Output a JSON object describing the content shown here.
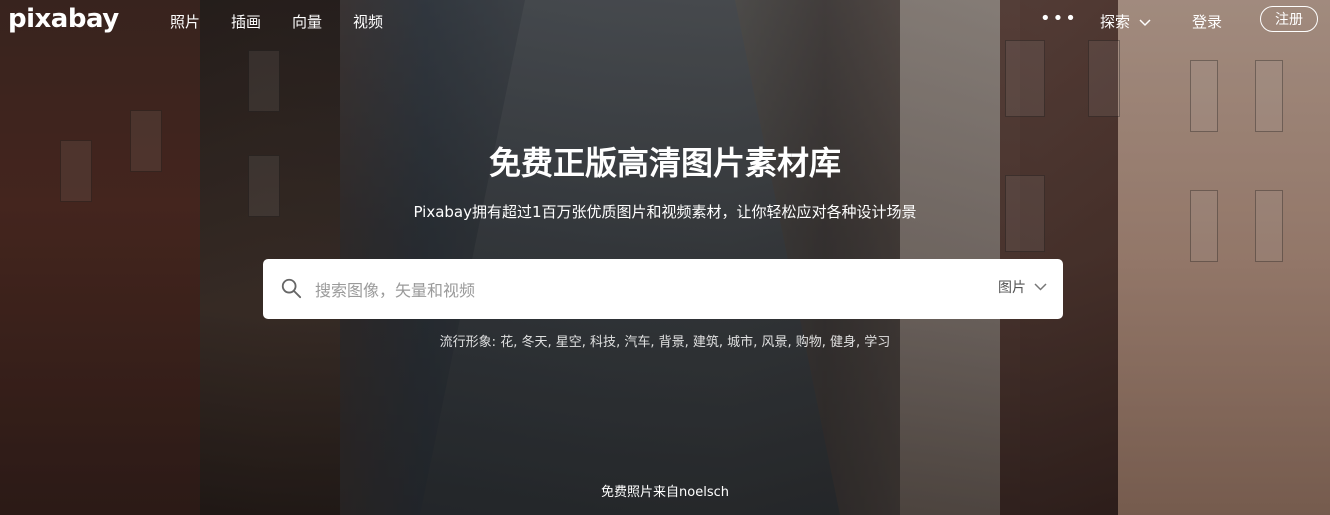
{
  "header": {
    "logo": "pixabay",
    "nav": [
      "照片",
      "插画",
      "向量",
      "视频"
    ],
    "more_label": "•••",
    "explore_label": "探索",
    "login_label": "登录",
    "signup_label": "注册"
  },
  "hero": {
    "headline": "免费正版高清图片素材库",
    "subline": "Pixabay拥有超过1百万张优质图片和视频素材，让你轻松应对各种设计场景"
  },
  "search": {
    "placeholder": "搜索图像，矢量和视频",
    "type_label": "图片"
  },
  "trending": {
    "label": "流行形象:",
    "items": [
      "花",
      "冬天",
      "星空",
      "科技",
      "汽车",
      "背景",
      "建筑",
      "城市",
      "风景",
      "购物",
      "健身",
      "学习"
    ]
  },
  "credit": {
    "prefix": "免费照片来自",
    "author": "noelsch"
  }
}
